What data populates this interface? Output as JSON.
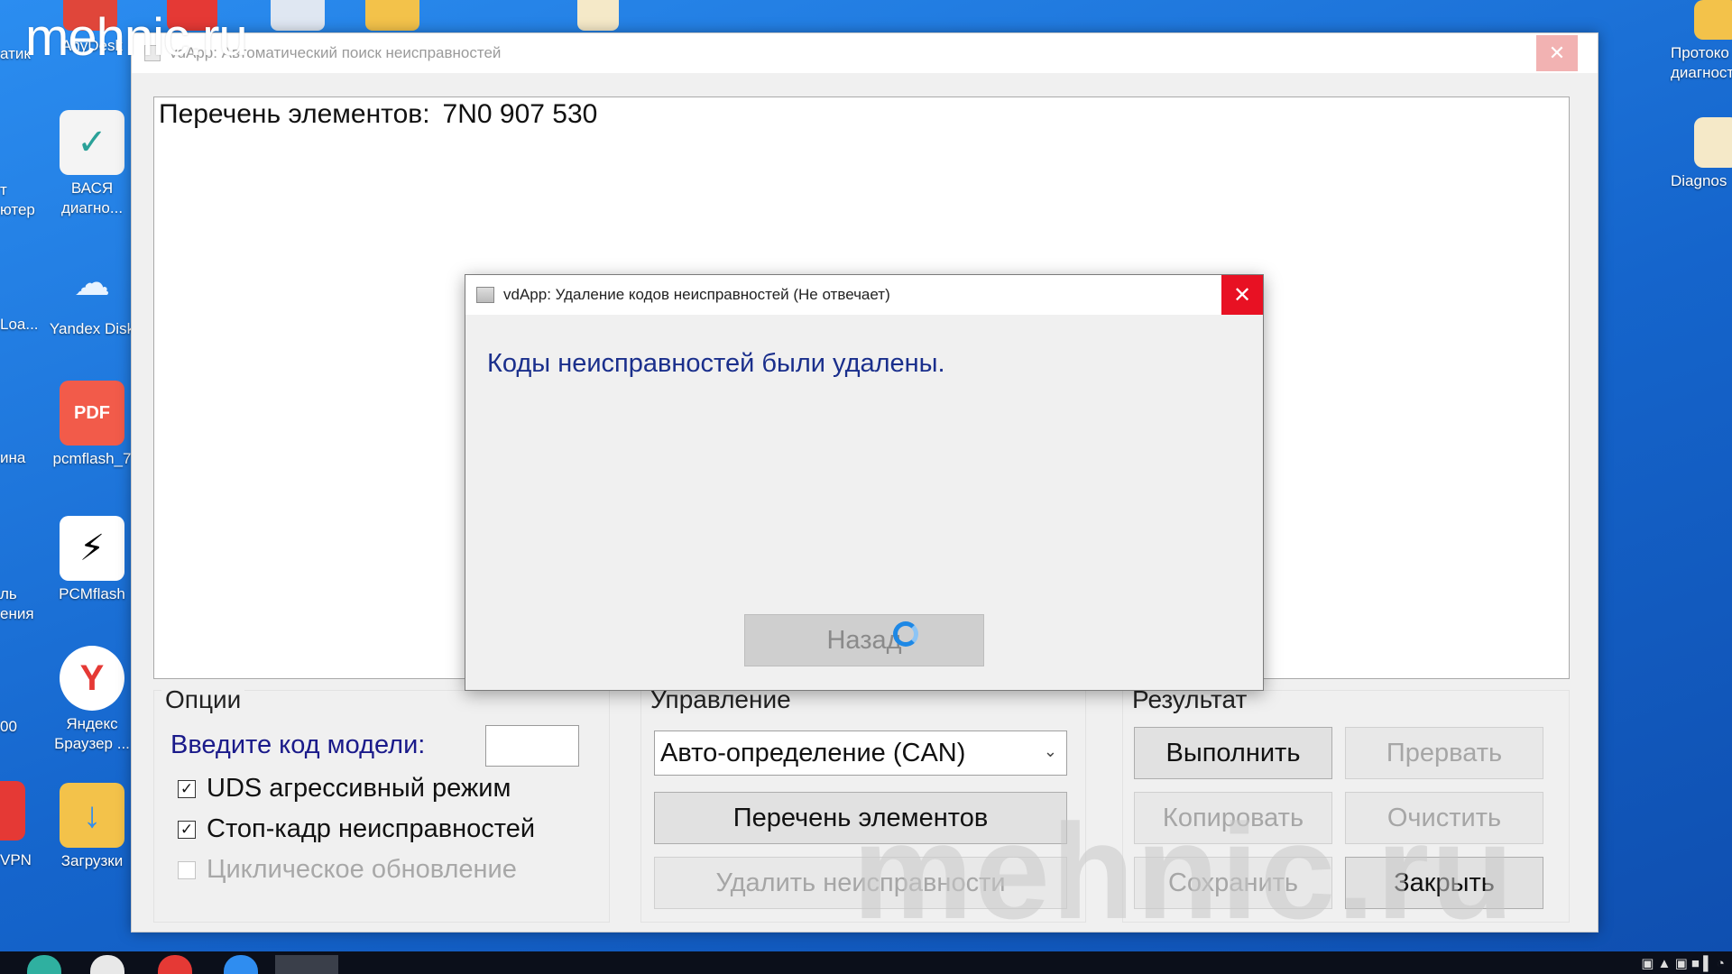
{
  "watermark": "mehnic.ru",
  "desktop": {
    "left_icons": [
      {
        "label": "AnyDesk",
        "color": "#e0463a"
      },
      {
        "label": "ВАСЯ диагно...",
        "color": "#f4f4f4"
      },
      {
        "label": "Yandex Disk",
        "color": "#2f8df0"
      },
      {
        "label": "pcmflash_7",
        "color": "#ffffff"
      },
      {
        "label": "PCMflash",
        "color": "#ffffff"
      },
      {
        "label": "Яндекс Браузер ...",
        "color": "#ffffff"
      },
      {
        "label": "Загрузки",
        "color": "#f3c24a"
      }
    ],
    "cut_labels": [
      "атик",
      "т\nютер",
      "Loa...",
      "ина",
      "ль\nения",
      "00",
      "VPN"
    ],
    "right_icons": [
      {
        "label": "Протоко диагност"
      },
      {
        "label": "Diagnos"
      }
    ]
  },
  "main_window": {
    "title": "vdApp: Автоматический поиск неисправностей",
    "list_label": "Перечень элементов:",
    "list_code": "7N0 907 530",
    "options": {
      "title": "Опции",
      "model_label": "Введите код модели:",
      "model_value": "",
      "checks": [
        {
          "label": "UDS агрессивный режим",
          "checked": true,
          "enabled": true
        },
        {
          "label": "Стоп-кадр неисправностей",
          "checked": true,
          "enabled": true
        },
        {
          "label": "Циклическое обновление",
          "checked": false,
          "enabled": false
        }
      ]
    },
    "control": {
      "title": "Управление",
      "select_value": "Авто-определение (CAN)",
      "list_button": "Перечень элементов",
      "delete_button": "Удалить неисправности"
    },
    "result": {
      "title": "Результат",
      "run": "Выполнить",
      "stop": "Прервать",
      "copy": "Копировать",
      "clear": "Очистить",
      "save": "Сохранить",
      "close": "Закрыть"
    }
  },
  "dialog": {
    "title": "vdApp: Удаление кодов неисправностей (Не отвечает)",
    "message": "Коды неисправностей были удалены.",
    "back_button": "Назад"
  },
  "colors": {
    "close_red": "#e81123",
    "message_blue": "#1a2f8c",
    "label_blue": "#1a1a8a"
  }
}
